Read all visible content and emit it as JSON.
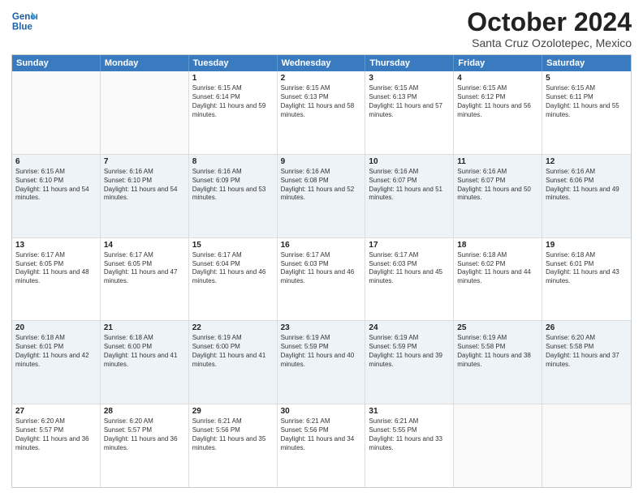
{
  "header": {
    "logo_line1": "General",
    "logo_line2": "Blue",
    "month": "October 2024",
    "location": "Santa Cruz Ozolotepec, Mexico"
  },
  "days": [
    "Sunday",
    "Monday",
    "Tuesday",
    "Wednesday",
    "Thursday",
    "Friday",
    "Saturday"
  ],
  "rows": [
    [
      {
        "date": "",
        "info": ""
      },
      {
        "date": "",
        "info": ""
      },
      {
        "date": "1",
        "info": "Sunrise: 6:15 AM\nSunset: 6:14 PM\nDaylight: 11 hours and 59 minutes."
      },
      {
        "date": "2",
        "info": "Sunrise: 6:15 AM\nSunset: 6:13 PM\nDaylight: 11 hours and 58 minutes."
      },
      {
        "date": "3",
        "info": "Sunrise: 6:15 AM\nSunset: 6:13 PM\nDaylight: 11 hours and 57 minutes."
      },
      {
        "date": "4",
        "info": "Sunrise: 6:15 AM\nSunset: 6:12 PM\nDaylight: 11 hours and 56 minutes."
      },
      {
        "date": "5",
        "info": "Sunrise: 6:15 AM\nSunset: 6:11 PM\nDaylight: 11 hours and 55 minutes."
      }
    ],
    [
      {
        "date": "6",
        "info": "Sunrise: 6:15 AM\nSunset: 6:10 PM\nDaylight: 11 hours and 54 minutes."
      },
      {
        "date": "7",
        "info": "Sunrise: 6:16 AM\nSunset: 6:10 PM\nDaylight: 11 hours and 54 minutes."
      },
      {
        "date": "8",
        "info": "Sunrise: 6:16 AM\nSunset: 6:09 PM\nDaylight: 11 hours and 53 minutes."
      },
      {
        "date": "9",
        "info": "Sunrise: 6:16 AM\nSunset: 6:08 PM\nDaylight: 11 hours and 52 minutes."
      },
      {
        "date": "10",
        "info": "Sunrise: 6:16 AM\nSunset: 6:07 PM\nDaylight: 11 hours and 51 minutes."
      },
      {
        "date": "11",
        "info": "Sunrise: 6:16 AM\nSunset: 6:07 PM\nDaylight: 11 hours and 50 minutes."
      },
      {
        "date": "12",
        "info": "Sunrise: 6:16 AM\nSunset: 6:06 PM\nDaylight: 11 hours and 49 minutes."
      }
    ],
    [
      {
        "date": "13",
        "info": "Sunrise: 6:17 AM\nSunset: 6:05 PM\nDaylight: 11 hours and 48 minutes."
      },
      {
        "date": "14",
        "info": "Sunrise: 6:17 AM\nSunset: 6:05 PM\nDaylight: 11 hours and 47 minutes."
      },
      {
        "date": "15",
        "info": "Sunrise: 6:17 AM\nSunset: 6:04 PM\nDaylight: 11 hours and 46 minutes."
      },
      {
        "date": "16",
        "info": "Sunrise: 6:17 AM\nSunset: 6:03 PM\nDaylight: 11 hours and 46 minutes."
      },
      {
        "date": "17",
        "info": "Sunrise: 6:17 AM\nSunset: 6:03 PM\nDaylight: 11 hours and 45 minutes."
      },
      {
        "date": "18",
        "info": "Sunrise: 6:18 AM\nSunset: 6:02 PM\nDaylight: 11 hours and 44 minutes."
      },
      {
        "date": "19",
        "info": "Sunrise: 6:18 AM\nSunset: 6:01 PM\nDaylight: 11 hours and 43 minutes."
      }
    ],
    [
      {
        "date": "20",
        "info": "Sunrise: 6:18 AM\nSunset: 6:01 PM\nDaylight: 11 hours and 42 minutes."
      },
      {
        "date": "21",
        "info": "Sunrise: 6:18 AM\nSunset: 6:00 PM\nDaylight: 11 hours and 41 minutes."
      },
      {
        "date": "22",
        "info": "Sunrise: 6:19 AM\nSunset: 6:00 PM\nDaylight: 11 hours and 41 minutes."
      },
      {
        "date": "23",
        "info": "Sunrise: 6:19 AM\nSunset: 5:59 PM\nDaylight: 11 hours and 40 minutes."
      },
      {
        "date": "24",
        "info": "Sunrise: 6:19 AM\nSunset: 5:59 PM\nDaylight: 11 hours and 39 minutes."
      },
      {
        "date": "25",
        "info": "Sunrise: 6:19 AM\nSunset: 5:58 PM\nDaylight: 11 hours and 38 minutes."
      },
      {
        "date": "26",
        "info": "Sunrise: 6:20 AM\nSunset: 5:58 PM\nDaylight: 11 hours and 37 minutes."
      }
    ],
    [
      {
        "date": "27",
        "info": "Sunrise: 6:20 AM\nSunset: 5:57 PM\nDaylight: 11 hours and 36 minutes."
      },
      {
        "date": "28",
        "info": "Sunrise: 6:20 AM\nSunset: 5:57 PM\nDaylight: 11 hours and 36 minutes."
      },
      {
        "date": "29",
        "info": "Sunrise: 6:21 AM\nSunset: 5:56 PM\nDaylight: 11 hours and 35 minutes."
      },
      {
        "date": "30",
        "info": "Sunrise: 6:21 AM\nSunset: 5:56 PM\nDaylight: 11 hours and 34 minutes."
      },
      {
        "date": "31",
        "info": "Sunrise: 6:21 AM\nSunset: 5:55 PM\nDaylight: 11 hours and 33 minutes."
      },
      {
        "date": "",
        "info": ""
      },
      {
        "date": "",
        "info": ""
      }
    ]
  ]
}
